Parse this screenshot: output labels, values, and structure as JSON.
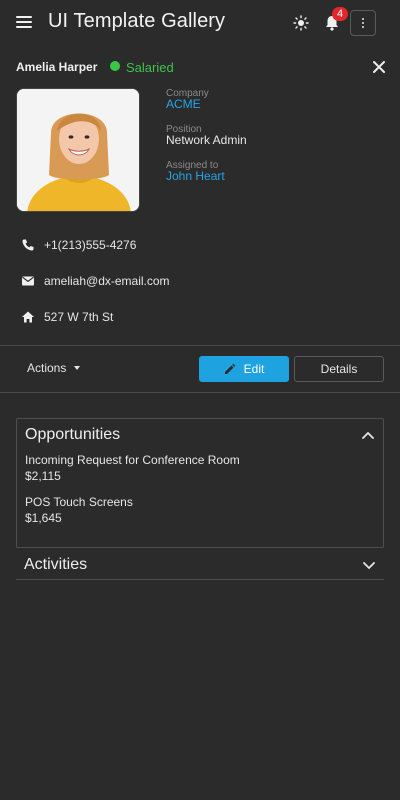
{
  "header": {
    "title": "UI Template Gallery",
    "notification_count": "4",
    "icons": [
      "menu-icon",
      "sun-icon",
      "bell-icon",
      "more-vertical-icon"
    ]
  },
  "contact": {
    "name": "Amelia Harper",
    "status": "Salaried",
    "status_color": "#37c845",
    "company_label": "Company",
    "company": "ACME",
    "position_label": "Position",
    "position": "Network Admin",
    "assigned_label": "Assigned to",
    "assigned_to": "John Heart",
    "phone": "+1(213)555-4276",
    "email": "ameliah@dx-email.com",
    "address": "527 W 7th St"
  },
  "toolbar": {
    "actions_label": "Actions",
    "edit_label": "Edit",
    "details_label": "Details"
  },
  "opportunities": {
    "title": "Opportunities",
    "items": [
      {
        "title": "Incoming Request for Conference Room",
        "value": "$2,115"
      },
      {
        "title": "POS Touch Screens",
        "value": "$1,645"
      }
    ]
  },
  "activities": {
    "title": "Activities"
  },
  "colors": {
    "background": "#2b2b2b",
    "accent": "#1ea2e0",
    "link": "#28a4e4",
    "badge": "#e3262b"
  }
}
